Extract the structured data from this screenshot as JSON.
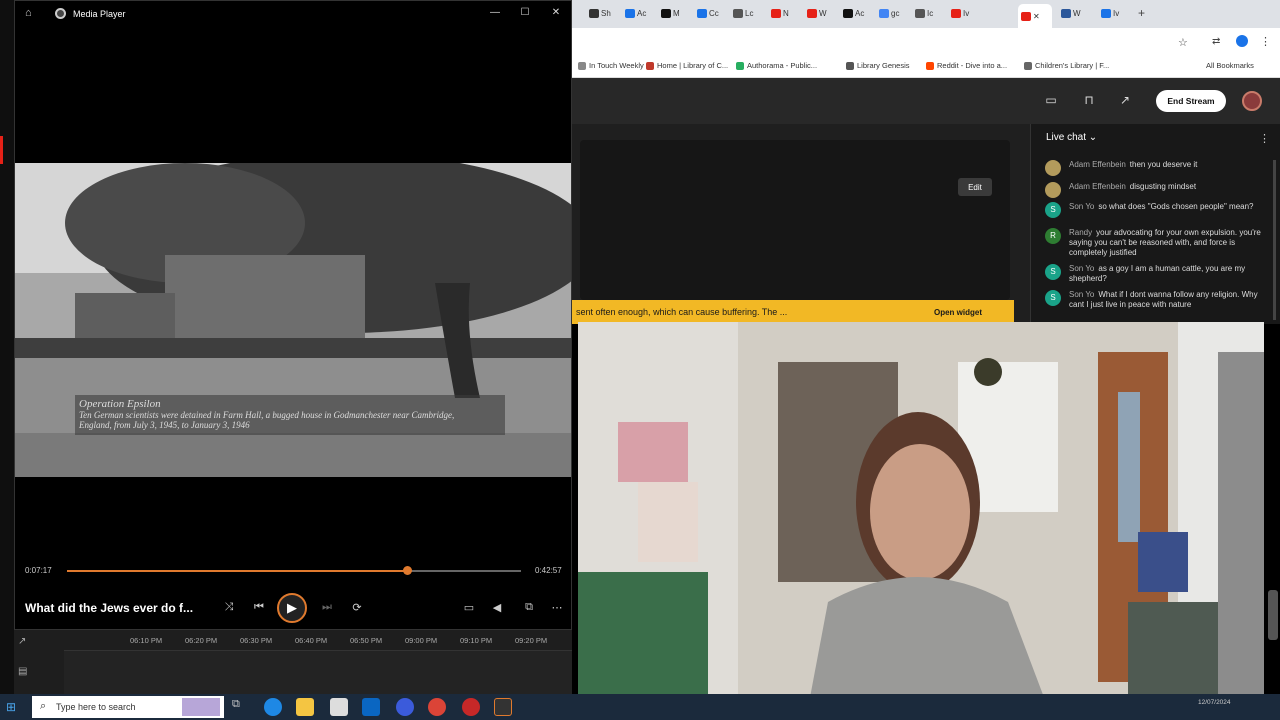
{
  "browser": {
    "tabs": [
      {
        "label": "Sh",
        "color": "#333"
      },
      {
        "label": "Ac",
        "color": "#1a73e8"
      },
      {
        "label": "M",
        "color": "#111"
      },
      {
        "label": "Cc",
        "color": "#1a73e8"
      },
      {
        "label": "Lc",
        "color": "#555"
      },
      {
        "label": "N",
        "color": "#e62117"
      },
      {
        "label": "W",
        "color": "#e62117"
      },
      {
        "label": "Ac",
        "color": "#111"
      },
      {
        "label": "gc",
        "color": "#4285f4"
      },
      {
        "label": "Ic",
        "color": "#555"
      },
      {
        "label": "Iv",
        "color": "#e62117"
      }
    ],
    "active_tab_close": "✕",
    "tabs_after": [
      {
        "label": "W",
        "color": "#2b579a"
      },
      {
        "label": "Iv",
        "color": "#1a73e8"
      }
    ],
    "new_tab": "+",
    "bookmarks": [
      {
        "label": "In Touch Weekly",
        "color": "#888"
      },
      {
        "label": "Home | Library of C...",
        "color": "#c0392b"
      },
      {
        "label": "Authorama - Public...",
        "color": "#27ae60"
      },
      {
        "label": "Library Genesis",
        "color": "#555"
      },
      {
        "label": "Reddit - Dive into a...",
        "color": "#ff4500"
      },
      {
        "label": "Children's Library | F...",
        "color": "#666"
      }
    ],
    "all_bookmarks": "All Bookmarks"
  },
  "studio": {
    "end_stream": "End Stream",
    "edit": "Edit",
    "warning_text": "sent often enough, which can cause buffering. The ...",
    "open_widget": "Open widget"
  },
  "chat": {
    "title": "Live chat ⌄",
    "more": "⋮",
    "messages": [
      {
        "avatar": "",
        "color": "#b39b5c",
        "author": "Adam Effenbein",
        "text": "then you deserve it"
      },
      {
        "avatar": "",
        "color": "#b39b5c",
        "author": "Adam Effenbein",
        "text": "disgusting mindset"
      },
      {
        "avatar": "S",
        "color": "#1aa389",
        "author": "Son Yo",
        "text": "so what does \"Gods chosen people\" mean?"
      },
      {
        "avatar": "R",
        "color": "#2e7d32",
        "author": "Randy",
        "text": "your advocating for your own expulsion. you're saying you can't be reasoned with, and force is completely justified"
      },
      {
        "avatar": "S",
        "color": "#1aa389",
        "author": "Son Yo",
        "text": "as a goy I am a human cattle, you are my shepherd?"
      },
      {
        "avatar": "S",
        "color": "#1aa389",
        "author": "Son Yo",
        "text": "What if I dont wanna follow any religion. Why cant I just live in peace with nature"
      }
    ]
  },
  "player": {
    "window_title": "Media Player",
    "home_icon": "⌂",
    "minimize": "—",
    "maximize": "☐",
    "close": "✕",
    "caption_title": "Operation Epsilon",
    "caption_line1": "Ten German scientists were detained in Farm Hall, a bugged house in Godmanchester near Cambridge,",
    "caption_line2": "England, from July 3, 1945, to January 3, 1946",
    "time_current": "0:07:17",
    "time_total": "0:42:57",
    "progress_fraction": 0.7485,
    "now_playing": "What did the Jews ever do f...",
    "shuffle": "⤨",
    "prev": "⏮",
    "play": "▶",
    "next": "⏭",
    "repeat": "⟳",
    "miniplayer": "▭",
    "volume": "◀",
    "cast": "⧉",
    "more": "⋯"
  },
  "timeline": {
    "ticks": [
      "06:10 PM",
      "06:20 PM",
      "06:30 PM",
      "06:40 PM",
      "06:50 PM",
      "09:00 PM",
      "09:10 PM",
      "09:20 PM"
    ]
  },
  "taskbar": {
    "start": "⊞",
    "search_icon": "⌕",
    "search_placeholder": "Type here to search",
    "time": "12/07/2024"
  }
}
